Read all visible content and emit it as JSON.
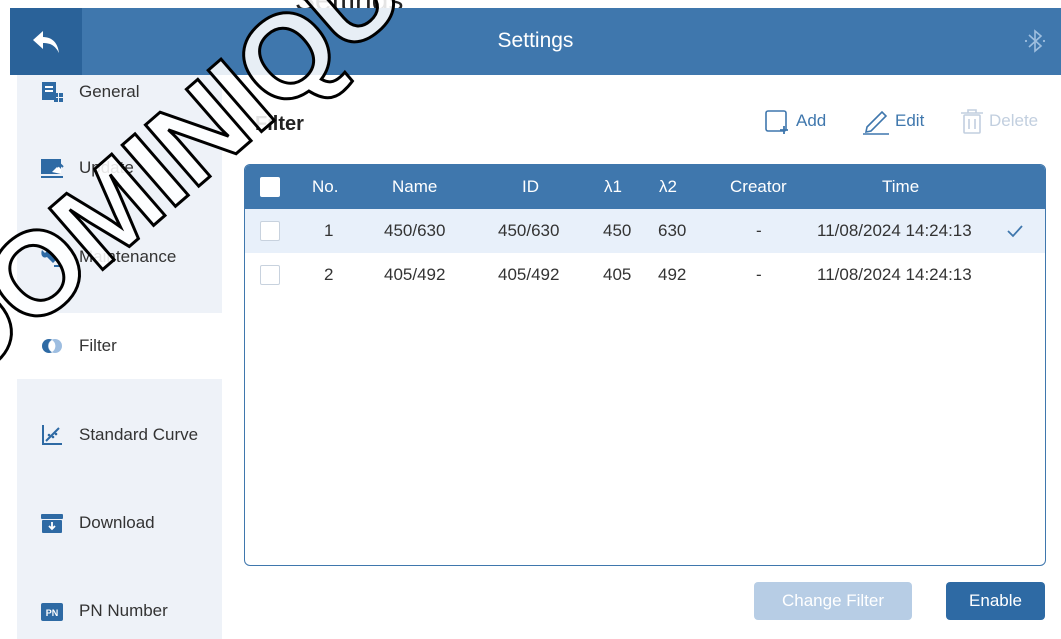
{
  "top_caption": "Settings",
  "header": {
    "title": "Settings",
    "back_icon": "back-arrow-icon",
    "bluetooth_icon": "bluetooth-icon"
  },
  "sidebar": {
    "items": [
      {
        "label": "General",
        "icon": "general-icon"
      },
      {
        "label": "Update",
        "icon": "update-icon"
      },
      {
        "label": "Maintenance",
        "icon": "maintenance-icon"
      },
      {
        "label": "Filter",
        "icon": "filter-icon",
        "active": true
      },
      {
        "label": "Standard Curve",
        "icon": "standard-curve-icon"
      },
      {
        "label": "Download",
        "icon": "download-icon"
      },
      {
        "label": "PN Number",
        "icon": "pn-number-icon",
        "badge": "PN"
      }
    ]
  },
  "main": {
    "title": "Filter",
    "toolbar": {
      "add": "Add",
      "edit": "Edit",
      "delete": "Delete"
    },
    "table": {
      "columns": [
        "No.",
        "Name",
        "ID",
        "λ1",
        "λ2",
        "Creator",
        "Time"
      ],
      "rows": [
        {
          "no": "1",
          "name": "450/630",
          "id": "450/630",
          "l1": "450",
          "l2": "630",
          "creator": "-",
          "time": "11/08/2024 14:24:13",
          "selected": true
        },
        {
          "no": "2",
          "name": "405/492",
          "id": "405/492",
          "l1": "405",
          "l2": "492",
          "creator": "-",
          "time": "11/08/2024 14:24:13",
          "selected": false
        }
      ]
    },
    "buttons": {
      "change_filter": "Change Filter",
      "enable": "Enable"
    }
  },
  "watermark": "DOMINIQUE DUTSCHER",
  "colors": {
    "primary": "#3f77ad",
    "dark": "#2e6aa4",
    "sidebar_bg": "#eef2f8",
    "disabled": "#b7cde5"
  }
}
